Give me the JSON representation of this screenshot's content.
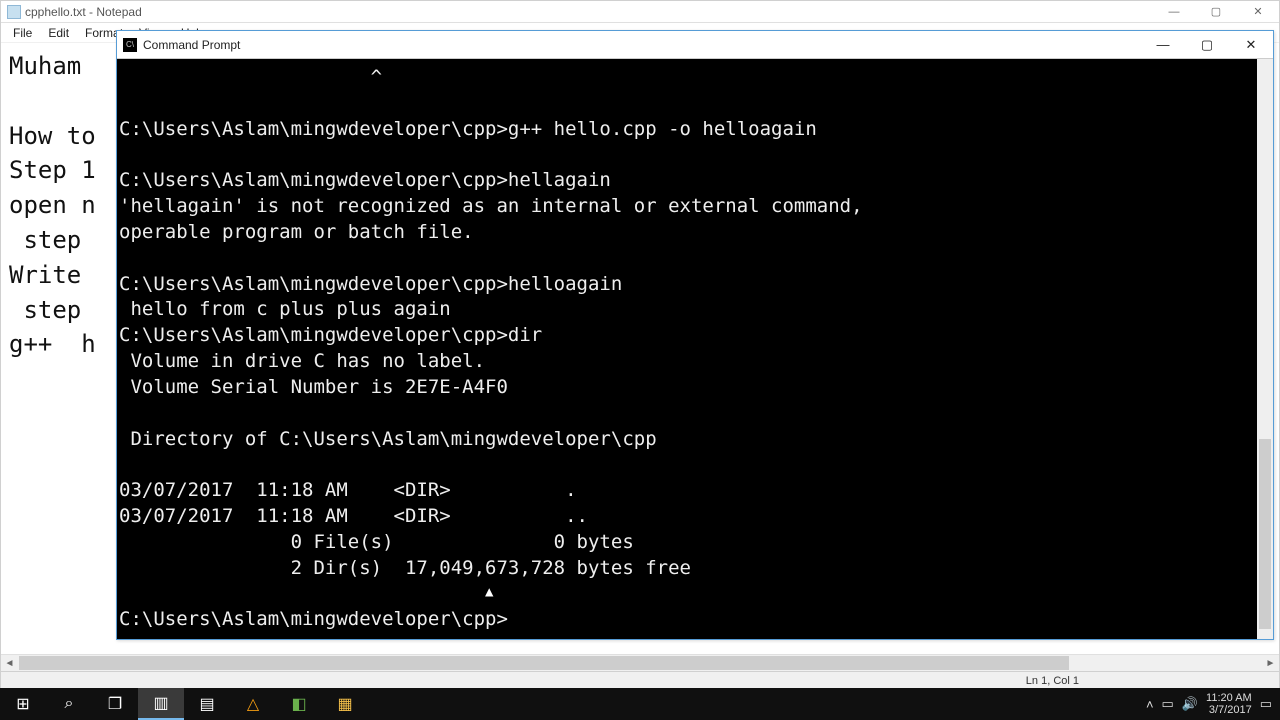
{
  "notepad": {
    "title": "cpphello.txt - Notepad",
    "menu": [
      "File",
      "Edit",
      "Format",
      "View",
      "Help"
    ],
    "body_lines": [
      "Muham",
      "",
      "How to",
      "Step 1",
      "open n",
      " step",
      "Write",
      " step",
      "g++  h"
    ],
    "status": "Ln 1, Col 1",
    "ctrl": {
      "min": "—",
      "max": "▢",
      "close": "✕"
    }
  },
  "cmd": {
    "title": "Command Prompt",
    "ctrl": {
      "min": "—",
      "max": "▢",
      "close": "✕"
    },
    "lines": [
      "                      ^",
      "",
      "C:\\Users\\Aslam\\mingwdeveloper\\cpp>g++ hello.cpp -o helloagain",
      "",
      "C:\\Users\\Aslam\\mingwdeveloper\\cpp>hellagain",
      "'hellagain' is not recognized as an internal or external command,",
      "operable program or batch file.",
      "",
      "C:\\Users\\Aslam\\mingwdeveloper\\cpp>helloagain",
      " hello from c plus plus again",
      "C:\\Users\\Aslam\\mingwdeveloper\\cpp>dir",
      " Volume in drive C has no label.",
      " Volume Serial Number is 2E7E-A4F0",
      "",
      " Directory of C:\\Users\\Aslam\\mingwdeveloper\\cpp",
      "",
      "03/07/2017  11:18 AM    <DIR>          .",
      "03/07/2017  11:18 AM    <DIR>          ..",
      "               0 File(s)              0 bytes",
      "               2 Dir(s)  17,049,673,728 bytes free",
      "",
      "C:\\Users\\Aslam\\mingwdeveloper\\cpp>"
    ]
  },
  "taskbar": {
    "icons": {
      "start": "⊞",
      "search": "⌕",
      "taskview": "❐",
      "explorer": "▥",
      "notepad": "▤",
      "vlc": "△",
      "sublime": "◧",
      "folder": "▦"
    },
    "tray": {
      "up": "˄",
      "net": "▭",
      "sound": "🔊",
      "time": "11:20 AM",
      "date": "3/7/2017",
      "notif": "▭"
    }
  }
}
